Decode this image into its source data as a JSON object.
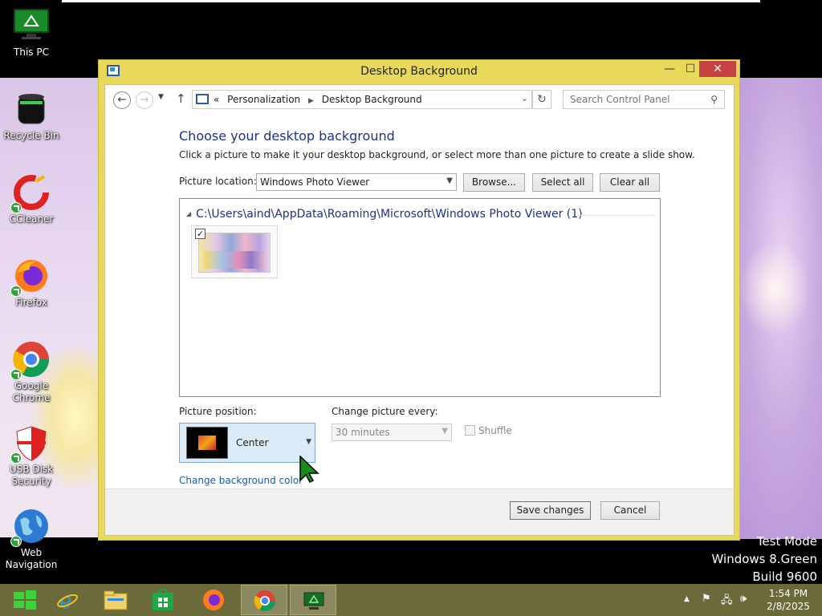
{
  "desktop": {
    "icons": [
      {
        "label": "This PC"
      },
      {
        "label": "Recycle Bin"
      },
      {
        "label": "CCleaner"
      },
      {
        "label": "Firefox"
      },
      {
        "label": "Google Chrome"
      },
      {
        "label": "USB Disk Security"
      },
      {
        "label": "Web Navigation"
      }
    ],
    "watermark": {
      "line1": "Test Mode",
      "line2": "Windows 8.Green",
      "line3": "Build 9600"
    }
  },
  "window": {
    "title": "Desktop Background",
    "minimize_glyph": "—",
    "maximize_glyph": "☐",
    "close_glyph": "✕",
    "nav": {
      "back_glyph": "←",
      "forward_glyph": "→",
      "up_glyph": "↑",
      "chevrons": "«",
      "breadcrumb": [
        "Personalization",
        "Desktop Background"
      ],
      "search_placeholder": "Search Control Panel"
    },
    "heading": "Choose your desktop background",
    "subtext": "Click a picture to make it your desktop background, or select more than one picture to create a slide show.",
    "picture_location_label": "Picture location:",
    "picture_location_value": "Windows Photo Viewer",
    "browse_label": "Browse...",
    "select_all_label": "Select all",
    "clear_all_label": "Clear all",
    "group_header": "C:\\Users\\aind\\AppData\\Roaming\\Microsoft\\Windows Photo Viewer (1)",
    "thumbnail_checked": true,
    "picture_position_label": "Picture position:",
    "picture_position_value": "Center",
    "change_every_label": "Change picture every:",
    "change_every_value": "30 minutes",
    "shuffle_label": "Shuffle",
    "bg_color_link": "Change background color",
    "save_label": "Save changes",
    "cancel_label": "Cancel"
  },
  "taskbar": {
    "items": [
      "start",
      "internet-explorer",
      "file-explorer",
      "store",
      "firefox",
      "chrome",
      "desktop-app"
    ],
    "time": "1:54 PM",
    "date": "2/8/2025"
  },
  "colors": {
    "window_frame": "#e8d95a",
    "taskbar": "#6b6a3a",
    "heading": "#1e3287",
    "close_button": "#c74242"
  }
}
